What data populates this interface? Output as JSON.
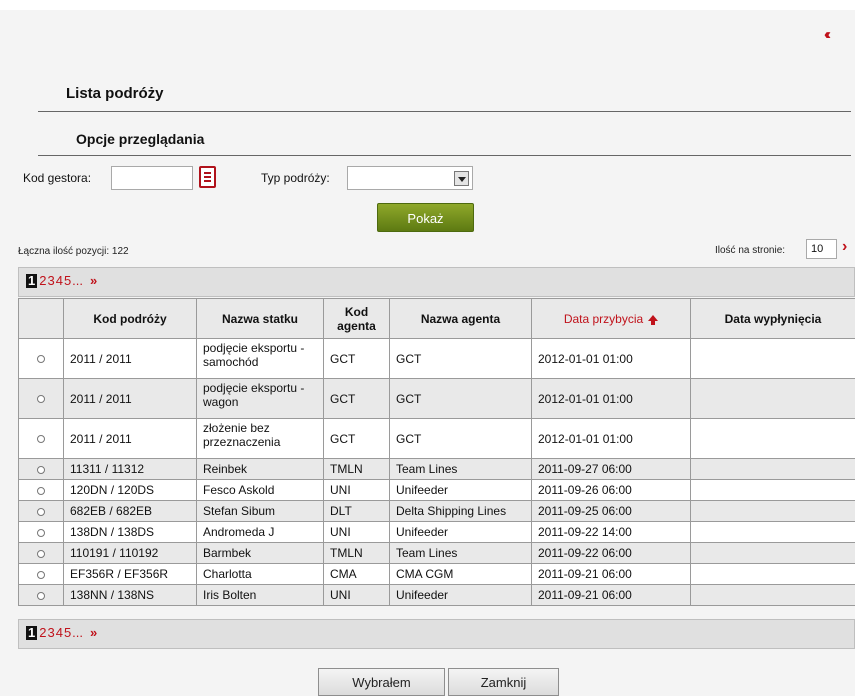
{
  "icons": {
    "collapse": "triple-chevron-left-icon",
    "book": "book-icon",
    "next_arrow": "chevron-right-icon",
    "sort": "arrow-up-icon"
  },
  "colors": {
    "accent_red": "#c0121b",
    "button_green": "#6e8c1c",
    "panel_bg": "#f4f4f4"
  },
  "collapse_glyph": "‹‹‹",
  "title": "Lista podróży",
  "subtitle": "Opcje przeglądania",
  "filters": {
    "kod_gestora_label": "Kod gestora:",
    "kod_gestora_value": "",
    "typ_podrozy_label": "Typ podróży:",
    "typ_podrozy_value": ""
  },
  "show_button": "Pokaż",
  "total_label": "Łączna ilość pozycji: 122",
  "per_page_label": "Ilość na stronie:",
  "per_page_value": "10",
  "pager": {
    "current": "1",
    "pages": [
      "2",
      "3",
      "4",
      "5"
    ],
    "ellipsis": "...",
    "next": "»"
  },
  "table": {
    "columns": [
      "",
      "Kod podróży",
      "Nazwa statku",
      "Kod agenta",
      "Nazwa agenta",
      "Data przybycia",
      "Data wypłynięcia"
    ],
    "rows": [
      [
        "2011 / 2011",
        "podjęcie eksportu - samochód",
        "GCT",
        "GCT",
        "2012-01-01 01:00",
        ""
      ],
      [
        "2011 / 2011",
        "podjęcie eksportu - wagon",
        "GCT",
        "GCT",
        "2012-01-01 01:00",
        ""
      ],
      [
        "2011 / 2011",
        "złożenie bez przeznaczenia",
        "GCT",
        "GCT",
        "2012-01-01 01:00",
        ""
      ],
      [
        "11311 / 11312",
        "Reinbek",
        "TMLN",
        "Team Lines",
        "2011-09-27 06:00",
        ""
      ],
      [
        "120DN / 120DS",
        "Fesco Askold",
        "UNI",
        "Unifeeder",
        "2011-09-26 06:00",
        ""
      ],
      [
        "682EB / 682EB",
        "Stefan Sibum",
        "DLT",
        "Delta Shipping Lines",
        "2011-09-25 06:00",
        ""
      ],
      [
        "138DN / 138DS",
        "Andromeda J",
        "UNI",
        "Unifeeder",
        "2011-09-22 14:00",
        ""
      ],
      [
        "110191 / 110192",
        "Barmbek",
        "TMLN",
        "Team Lines",
        "2011-09-22 06:00",
        ""
      ],
      [
        "EF356R / EF356R",
        "Charlotta",
        "CMA",
        "CMA CGM",
        "2011-09-21 06:00",
        ""
      ],
      [
        "138NN / 138NS",
        "Iris Bolten",
        "UNI",
        "Unifeeder",
        "2011-09-21 06:00",
        ""
      ]
    ]
  },
  "footer": {
    "select_button": "Wybrałem",
    "close_button": "Zamknij"
  }
}
